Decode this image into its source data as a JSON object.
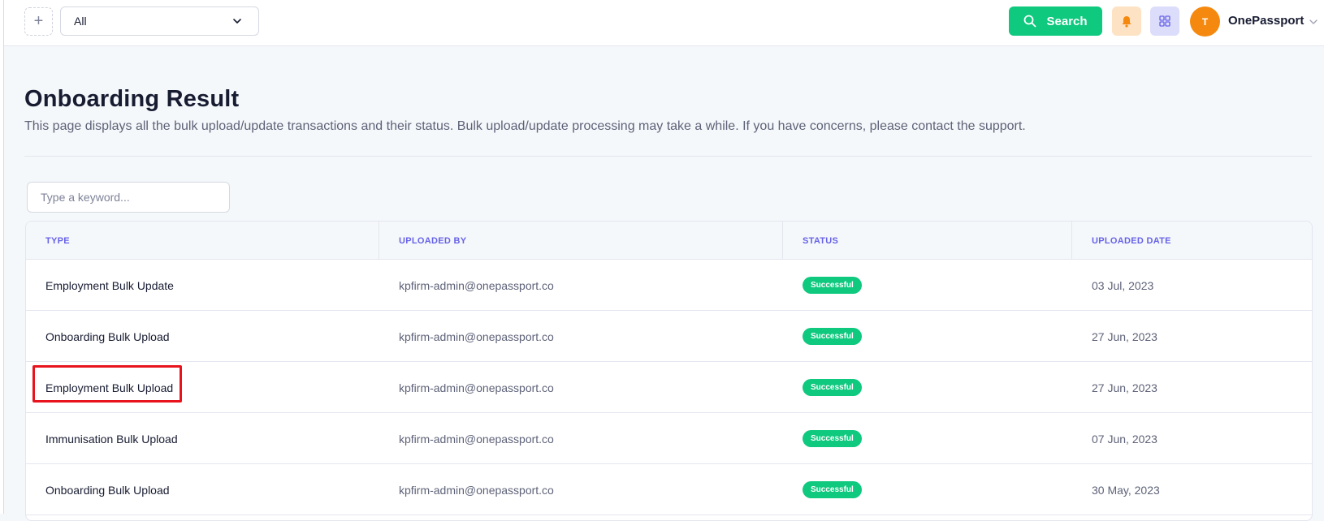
{
  "topbar": {
    "add_icon": "plus-icon",
    "filter_value": "All",
    "search_label": "Search",
    "bell_icon": "bell-icon",
    "apps_icon": "grid-icon",
    "avatar_initial": "T",
    "user_name": "OnePassport"
  },
  "page": {
    "title": "Onboarding Result",
    "description": "This page displays all the bulk upload/update transactions and their status. Bulk upload/update processing may take a while. If you have concerns, please contact the support."
  },
  "filter": {
    "placeholder": "Type a keyword..."
  },
  "table": {
    "columns": [
      "TYPE",
      "UPLOADED BY",
      "STATUS",
      "UPLOADED DATE"
    ],
    "rows": [
      {
        "type": "Employment Bulk Update",
        "uploaded_by": "kpfirm-admin@onepassport.co",
        "status": "Successful",
        "date": "03 Jul, 2023"
      },
      {
        "type": "Onboarding Bulk Upload",
        "uploaded_by": "kpfirm-admin@onepassport.co",
        "status": "Successful",
        "date": "27 Jun, 2023"
      },
      {
        "type": "Employment Bulk Upload",
        "uploaded_by": "kpfirm-admin@onepassport.co",
        "status": "Successful",
        "date": "27 Jun, 2023"
      },
      {
        "type": "Immunisation Bulk Upload",
        "uploaded_by": "kpfirm-admin@onepassport.co",
        "status": "Successful",
        "date": "07 Jun, 2023"
      },
      {
        "type": "Onboarding Bulk Upload",
        "uploaded_by": "kpfirm-admin@onepassport.co",
        "status": "Successful",
        "date": "30 May, 2023"
      }
    ]
  },
  "colors": {
    "accent_green": "#0ec97e",
    "header_text": "#6662e8",
    "avatar_bg": "#f5890f",
    "highlight": "#e8131c"
  }
}
